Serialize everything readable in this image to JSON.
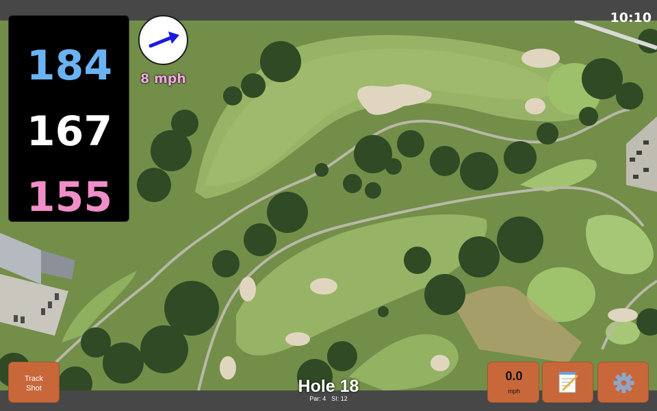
{
  "status_bar": {
    "time": "10:10"
  },
  "distances": {
    "back": "184",
    "middle": "167",
    "front": "155"
  },
  "wind": {
    "speed": "8 mph",
    "direction_icon": "wind-arrow-icon"
  },
  "buttons": {
    "track_shot_line1": "Track",
    "track_shot_line2": "Shot",
    "speed_value": "0.0",
    "speed_unit": "mph",
    "notes_icon": "notepad-icon",
    "settings_icon": "gear-icon"
  },
  "hole": {
    "title": "Hole 18",
    "par": "Par: 4",
    "si": "SI: 12"
  },
  "colors": {
    "back_distance": "#6bb2f2",
    "middle_distance": "#ffffff",
    "front_distance": "#ef8ec8",
    "button_bg": "#c8673a",
    "wind_arrow": "#1a1ae0"
  }
}
